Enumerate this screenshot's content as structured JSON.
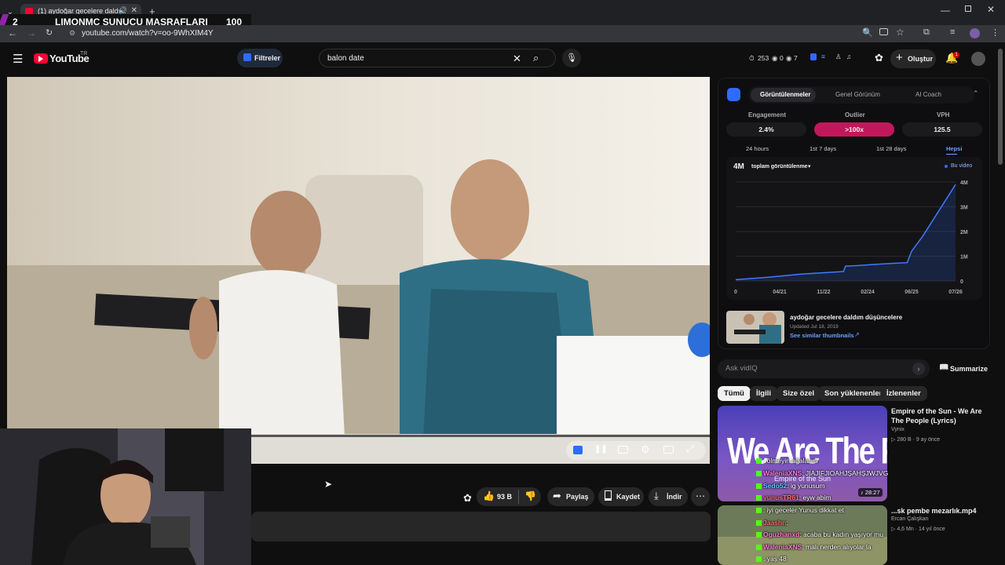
{
  "browser": {
    "tab_title": "(1) aydoğar gecelere daldı...",
    "url": "youtube.com/watch?v=oo-9WhXIM4Y"
  },
  "stream_overlay": {
    "rank": "2",
    "title": "LIMONMC SUNUCU MASRAFLARI",
    "count": "100"
  },
  "youtube": {
    "logo_text": "YouTube",
    "country": "TR",
    "filters_label": "Filtreler",
    "search_value": "balon date",
    "stats": {
      "views": "253",
      "a": "0",
      "b": "7"
    },
    "create_label": "Oluştur",
    "notif_count": "1"
  },
  "actions": {
    "like_count": "93 B",
    "share": "Paylaş",
    "save": "Kaydet",
    "download": "İndir"
  },
  "vidiq": {
    "tabs": [
      "Görüntülenmeler",
      "Genel Görünüm",
      "AI Coach"
    ],
    "metrics": [
      {
        "label": "Engagement",
        "value": "2.4%"
      },
      {
        "label": "Outlier",
        "value": ">100x"
      },
      {
        "label": "VPH",
        "value": "125.5"
      }
    ],
    "ranges": [
      "24 hours",
      "1st 7 days",
      "1st 28 days",
      "Hepsi"
    ],
    "total_value": "4M",
    "total_label": "toplam görüntülenme",
    "legend": "Bu video",
    "video_title": "aydoğar gecelere daldım düşüncelere",
    "video_updated": "Updated Jul 18, 2019",
    "similar": "See similar thumbnails",
    "ask_placeholder": "Ask vidIQ",
    "summarize": "Summarize"
  },
  "chart_data": {
    "type": "line",
    "title": "",
    "x": [
      "0",
      "04/21",
      "11/22",
      "02/24",
      "06/25",
      "07/26"
    ],
    "y_ticks": [
      "4M",
      "3M",
      "2M",
      "1M",
      "0"
    ],
    "ylim": [
      0,
      4000000
    ],
    "series": [
      {
        "name": "Bu video",
        "points": [
          [
            0,
            50000
          ],
          [
            0.15,
            150000
          ],
          [
            0.3,
            280000
          ],
          [
            0.49,
            380000
          ],
          [
            0.5,
            600000
          ],
          [
            0.55,
            620000
          ],
          [
            0.65,
            680000
          ],
          [
            0.78,
            740000
          ],
          [
            0.8,
            1200000
          ],
          [
            0.85,
            1800000
          ],
          [
            0.9,
            2500000
          ],
          [
            0.95,
            3200000
          ],
          [
            1,
            3900000
          ]
        ]
      }
    ]
  },
  "filter_chips": [
    "Tümü",
    "İlgili",
    "Size özel",
    "Son yüklenenler",
    "İzlenenler"
  ],
  "recommended": [
    {
      "title": "Empire of the Sun - We Are The People (Lyrics)",
      "channel": "Vynix",
      "meta": "280 B  ·  9 ay önce",
      "duration": "28:27",
      "thumb_text": "We Are The People",
      "thumb_sub": "Empire of the Sun"
    },
    {
      "title": "...sk pembe mezarlık.mp4",
      "channel": "Ercan Çalışkan",
      "meta": "4,6 Mn  ·  14 yıl önce"
    }
  ],
  "chat": [
    {
      "user": "",
      "msg": ": ölmeyin ağalarım"
    },
    {
      "user": "WaleniaXNS",
      "msg": ": JIAJIFJIOAHJŞAHŞJWJVG"
    },
    {
      "user": "Sedo52",
      "msg": ": ig yunusum"
    },
    {
      "user": "yunusTR61",
      "msg": ": eyw abim"
    },
    {
      "user": "",
      "msg": ": iyi geceler Yunus dikkat et"
    },
    {
      "user": "Jaashn",
      "msg": ":"
    },
    {
      "user": "Oguzhanxd",
      "msg": ": acaba bu kadın yaşıyor mu"
    },
    {
      "user": "WaleniaXNS",
      "msg": ": malı nerden alıyolar la"
    },
    {
      "user": "",
      "msg": ": yaş 48"
    }
  ],
  "colors": {
    "accent_red": "#ff0033",
    "vidiq_blue": "#2f6bff",
    "outlier_pink": "#c2185b"
  }
}
